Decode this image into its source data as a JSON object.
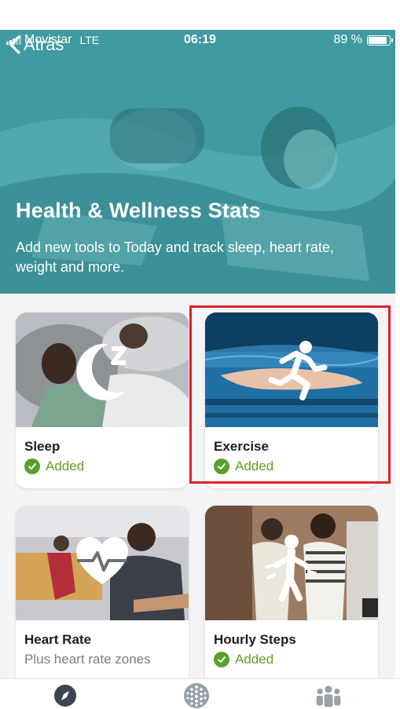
{
  "status_bar": {
    "carrier": "Movistar",
    "network": "LTE",
    "time": "06:19",
    "battery": "89 %",
    "battery_level": 0.89
  },
  "nav": {
    "back_label": "Atrás"
  },
  "hero": {
    "title": "Health & Wellness Stats",
    "subtitle": "Add new tools to Today and track sleep, heart rate, weight and more."
  },
  "cards": [
    {
      "name": "Sleep",
      "status": "Added",
      "icon": "moon-sleep-icon"
    },
    {
      "name": "Exercise",
      "status": "Added",
      "icon": "runner-icon"
    },
    {
      "name": "Heart Rate",
      "status": "Plus heart rate zones",
      "icon": "heart-pulse-icon"
    },
    {
      "name": "Hourly Steps",
      "status": "Added",
      "icon": "walking-person-icon"
    }
  ],
  "tab_bar": [
    {
      "icon": "compass-icon"
    },
    {
      "icon": "dots-grid-icon"
    },
    {
      "icon": "community-icon"
    }
  ],
  "colors": {
    "accent_green": "#5aa02c",
    "hero_teal": "#3f9aa2",
    "highlight_red": "#e0212b"
  }
}
